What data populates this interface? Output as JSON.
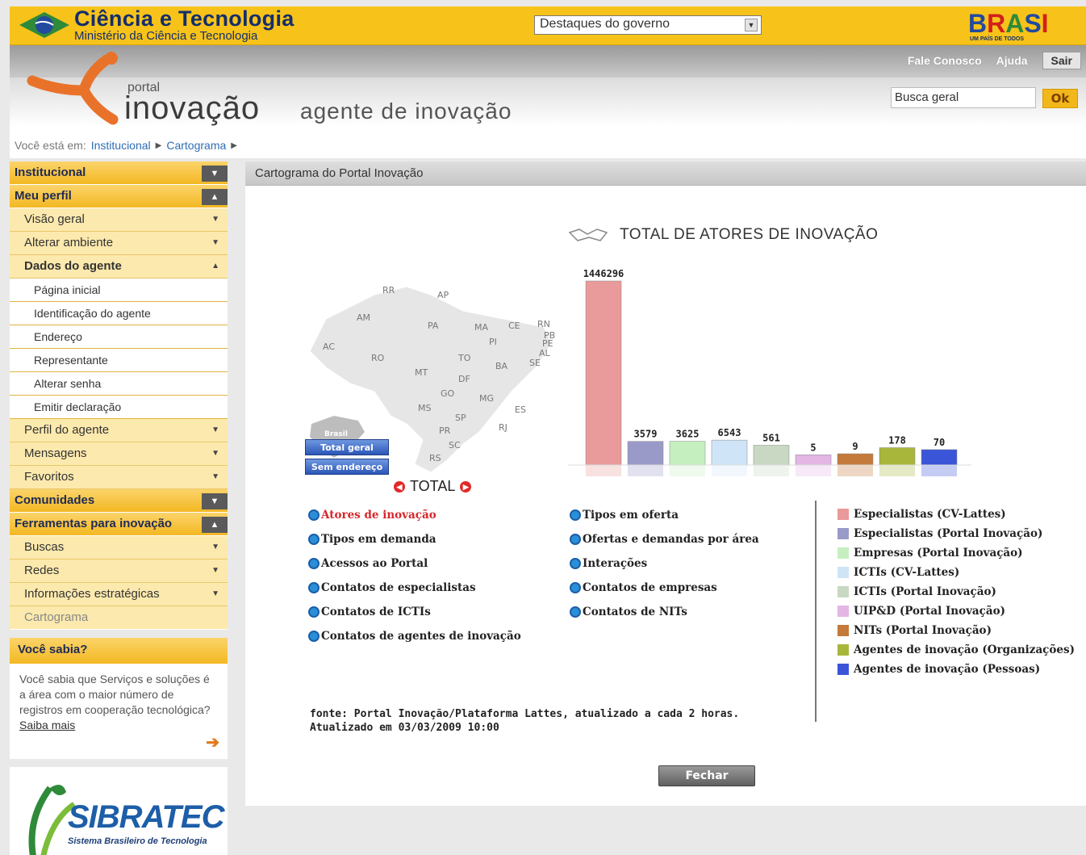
{
  "topbar": {
    "title": "Ciência e Tecnologia",
    "subtitle": "Ministério da Ciência e Tecnologia",
    "select_value": "Destaques do governo",
    "brand_logo": "BRASIL",
    "brand_slogan": "UM PAÍS DE TODOS"
  },
  "header": {
    "links": [
      "Fale Conosco",
      "Ajuda"
    ],
    "logout_label": "Sair",
    "portal_small": "portal",
    "portal_big": "inovação",
    "portal_tagline": "agente de inovação",
    "search_value": "Busca geral",
    "search_button": "Ok"
  },
  "breadcrumb": {
    "prefix": "Você está em:",
    "items": [
      "Institucional",
      "Cartograma"
    ]
  },
  "sidebar": {
    "institucional": "Institucional",
    "meu_perfil": "Meu perfil",
    "visao_geral": "Visão geral",
    "alterar_ambiente": "Alterar ambiente",
    "dados_agente": "Dados do agente",
    "leaf_items": [
      "Página inicial",
      "Identificação do agente",
      "Endereço",
      "Representante",
      "Alterar senha",
      "Emitir declaração"
    ],
    "perfil_agente": "Perfil do agente",
    "mensagens": "Mensagens",
    "favoritos": "Favoritos",
    "comunidades": "Comunidades",
    "ferramentas": "Ferramentas para inovação",
    "buscas": "Buscas",
    "redes": "Redes",
    "informacoes": "Informações estratégicas",
    "cartograma": "Cartograma",
    "sabia_title": "Você sabia?",
    "sabia_text": "Você sabia que Serviços e soluções é a área com o maior número de registros em cooperação tecnológica?",
    "sabia_link": "Saiba mais",
    "sibratec_logo": "SIBRATEC",
    "sibratec_sub": "Sistema Brasileiro de Tecnologia"
  },
  "main": {
    "panel_title": "Cartograma do Portal Inovação",
    "map_states": [
      "RR",
      "AP",
      "AM",
      "PA",
      "MA",
      "CE",
      "RN",
      "PB",
      "PE",
      "AL",
      "SE",
      "PI",
      "AC",
      "RO",
      "TO",
      "BA",
      "MT",
      "DF",
      "GO",
      "MG",
      "ES",
      "MS",
      "SP",
      "RJ",
      "PR",
      "SC",
      "RS"
    ],
    "mini_map_label": "Brasil",
    "map_buttons": [
      "Total geral",
      "Sem endereço"
    ],
    "total_label": "TOTAL",
    "links_left": [
      "Atores de inovação",
      "Tipos em demanda",
      "Acessos ao Portal",
      "Contatos de especialistas",
      "Contatos de ICTIs",
      "Contatos de agentes de inovação"
    ],
    "links_right": [
      "Tipos em oferta",
      "Ofertas e demandas por área",
      "Interações",
      "Contatos de empresas",
      "Contatos de NITs"
    ],
    "source_line1": "fonte: Portal Inovação/Plataforma Lattes, atualizado a cada 2 horas.",
    "source_line2": "Atualizado em 03/03/2009 10:00",
    "close_button": "Fechar"
  },
  "chart_data": {
    "type": "bar",
    "title": "TOTAL DE ATORES DE INOVAÇÃO",
    "categories": [
      "Especialistas (CV-Lattes)",
      "Especialistas (Portal Inovação)",
      "Empresas (Portal Inovação)",
      "ICTIs (CV-Lattes)",
      "ICTIs (Portal Inovação)",
      "UIP&D (Portal Inovação)",
      "NITs (Portal Inovação)",
      "Agentes de inovação (Organizações)",
      "Agentes de inovação (Pessoas)"
    ],
    "values": [
      1446296,
      3579,
      3625,
      6543,
      561,
      5,
      9,
      178,
      70
    ],
    "colors": [
      "#e99a9a",
      "#9a9ac9",
      "#c6efc0",
      "#cfe5f7",
      "#c9d8c2",
      "#e4b6e4",
      "#c47a3a",
      "#a9b63c",
      "#3a55d8"
    ],
    "legend_position": "right",
    "grid": false
  }
}
